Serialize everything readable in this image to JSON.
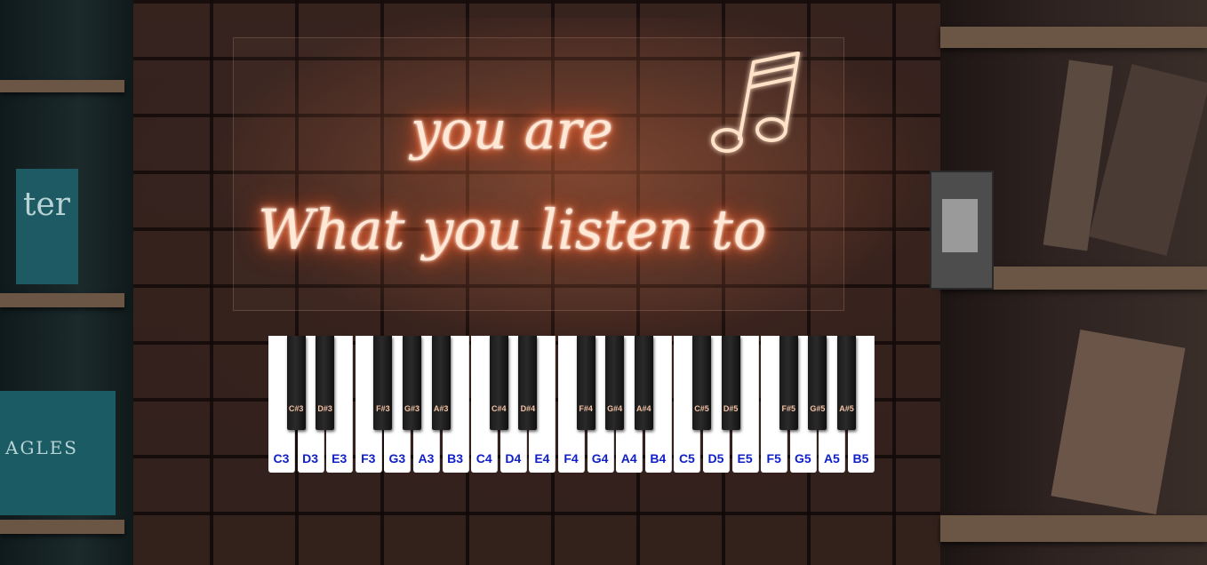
{
  "neon_sign": {
    "line1": "you are",
    "line2": "What you listen to"
  },
  "bookshelf": {
    "book1": "ter",
    "book2": "AGLES"
  },
  "piano": {
    "label_color": "#1020c8",
    "white_keys": [
      "C3",
      "D3",
      "E3",
      "F3",
      "G3",
      "A3",
      "B3",
      "C4",
      "D4",
      "E4",
      "F4",
      "G4",
      "A4",
      "B4",
      "C5",
      "D5",
      "E5",
      "F5",
      "G5",
      "A5",
      "B5"
    ],
    "black_keys": [
      "C#3",
      "D#3",
      "F#3",
      "G#3",
      "A#3",
      "C#4",
      "D#4",
      "F#4",
      "G#4",
      "A#4",
      "C#5",
      "D#5",
      "F#5",
      "G#5",
      "A#5"
    ]
  }
}
